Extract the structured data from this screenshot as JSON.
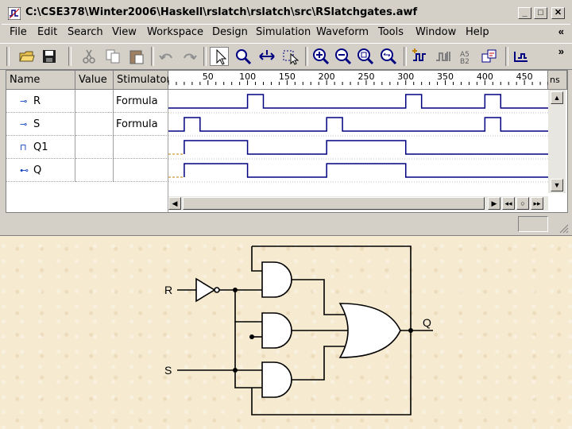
{
  "window": {
    "title": "C:\\CSE378\\Winter2006\\Haskell\\rslatch\\rslatch\\src\\RSlatchgates.awf",
    "controls": [
      "_",
      "□",
      "✕"
    ]
  },
  "menu": [
    {
      "label": "File"
    },
    {
      "label": "Edit"
    },
    {
      "label": "Search"
    },
    {
      "label": "View"
    },
    {
      "label": "Workspace"
    },
    {
      "label": "Design"
    },
    {
      "label": "Simulation"
    },
    {
      "label": "Waveform"
    },
    {
      "label": "Tools"
    },
    {
      "label": "Window"
    },
    {
      "label": "Help"
    }
  ],
  "menu_chevron": "«",
  "toolbar_chevron": "»",
  "toolbar_icons": [
    "open-icon",
    "save-icon",
    "cut-icon",
    "copy-icon",
    "paste-icon",
    "undo-icon",
    "redo-icon",
    "select-arrow-icon",
    "zoom-icon",
    "measure-icon",
    "select-range-icon",
    "zoom-in-icon",
    "zoom-out-icon",
    "zoom-fit-icon",
    "zoom-range-icon",
    "add-signal-icon",
    "edit-signal-icon",
    "bus-icon",
    "compare-icon",
    "timing-icon"
  ],
  "headers": {
    "name": "Name",
    "value": "Value",
    "stimulator": "Stimulator",
    "unit": "ns"
  },
  "ruler": {
    "ticks": [
      50,
      100,
      150,
      200,
      250,
      300,
      350,
      400,
      450
    ]
  },
  "signals": [
    {
      "name": "R",
      "value": "",
      "stimulator": "Formula",
      "kind": "input"
    },
    {
      "name": "S",
      "value": "",
      "stimulator": "Formula",
      "kind": "input"
    },
    {
      "name": "Q1",
      "value": "",
      "stimulator": "",
      "kind": "internal"
    },
    {
      "name": "Q",
      "value": "",
      "stimulator": "",
      "kind": "output"
    }
  ],
  "chart_data": {
    "type": "line",
    "xlabel": "ns",
    "xlim": [
      0,
      480
    ],
    "series": [
      {
        "name": "R",
        "high_intervals": [
          [
            100,
            120
          ],
          [
            300,
            320
          ],
          [
            400,
            420
          ]
        ]
      },
      {
        "name": "S",
        "high_intervals": [
          [
            20,
            40
          ],
          [
            200,
            220
          ],
          [
            400,
            420
          ]
        ]
      },
      {
        "name": "Q1",
        "undefined_until": 20,
        "high_intervals": [
          [
            20,
            100
          ],
          [
            200,
            300
          ]
        ]
      },
      {
        "name": "Q",
        "undefined_until": 20,
        "high_intervals": [
          [
            20,
            100
          ],
          [
            200,
            300
          ]
        ]
      }
    ]
  },
  "circuit": {
    "labels": {
      "r": "R",
      "s": "S",
      "q": "Q"
    }
  }
}
